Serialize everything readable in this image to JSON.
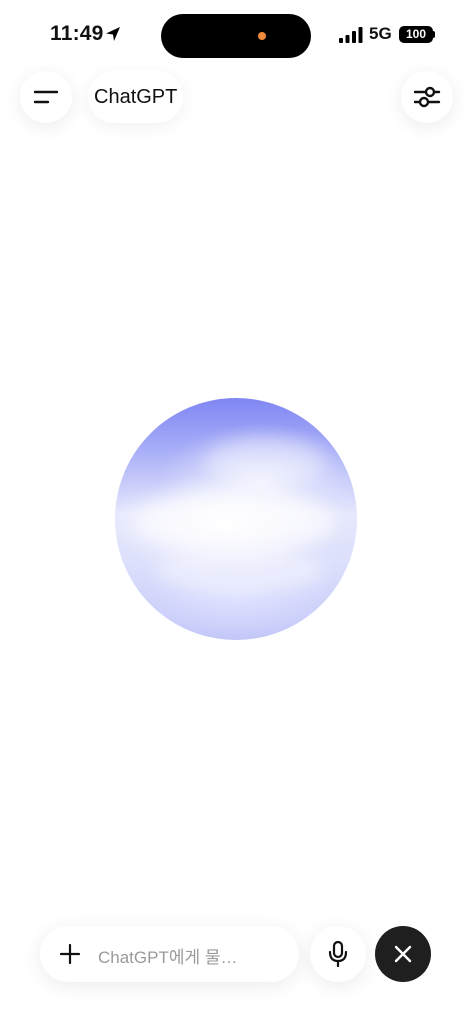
{
  "status_bar": {
    "time": "11:49",
    "network": "5G",
    "battery": "100",
    "icons": [
      "location-arrow-icon",
      "cellular-signal-icon",
      "battery-icon"
    ],
    "island_dot_color": "#f08a3c"
  },
  "header": {
    "title": "ChatGPT",
    "menu_icon": "menu-icon",
    "settings_icon": "sliders-icon"
  },
  "voice": {
    "orb_colors": [
      "#7f86f2",
      "#a9aff7",
      "#e6e8fd",
      "#b7bbf6"
    ]
  },
  "composer": {
    "placeholder": "ChatGPT에게 물…",
    "add_icon": "plus-icon",
    "mic_icon": "microphone-icon",
    "close_icon": "close-icon"
  }
}
